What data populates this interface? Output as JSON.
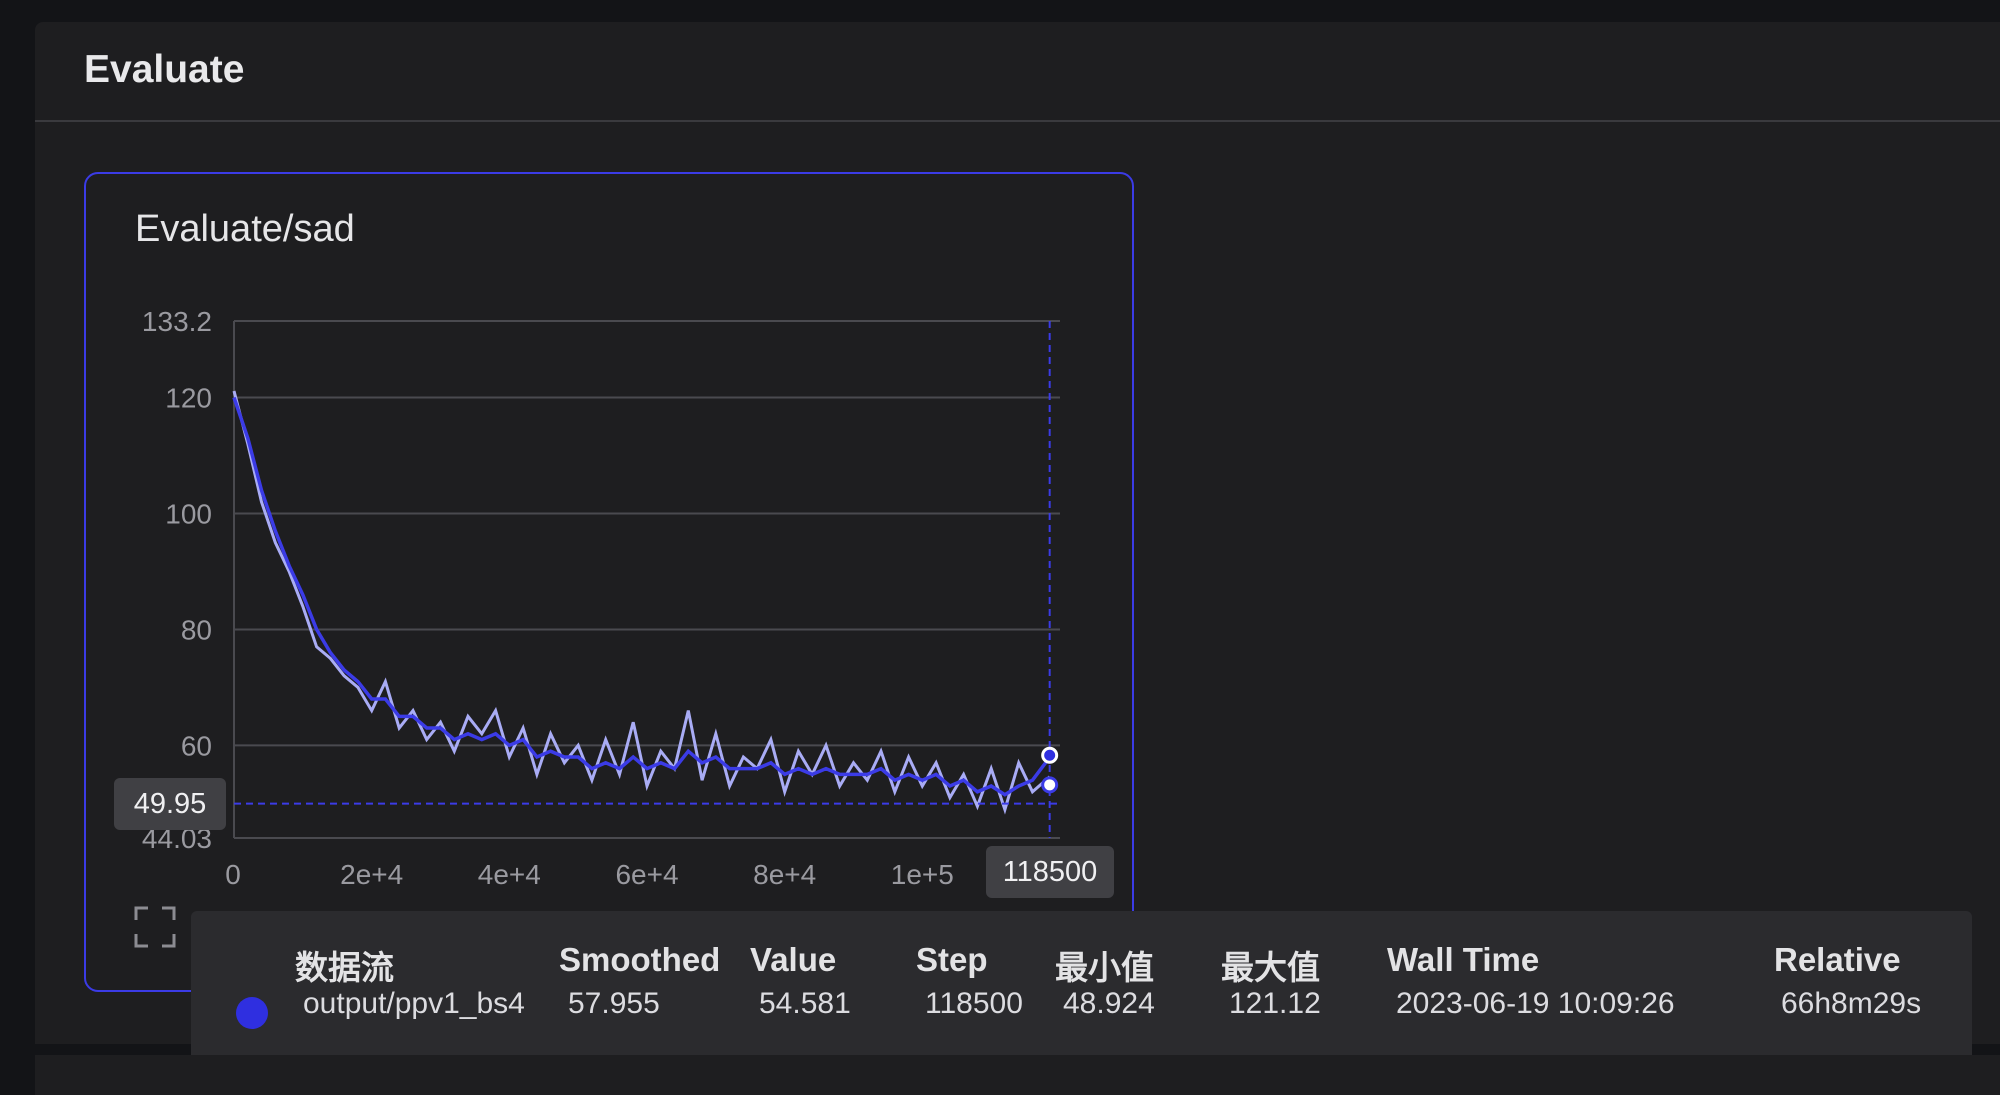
{
  "section": {
    "title": "Evaluate"
  },
  "card": {
    "title": "Evaluate/sad"
  },
  "colors": {
    "accent": "#2f2fe0",
    "smoothed": "#3b3be6",
    "raw": "#a9acf5",
    "card_border": "#3b3be6"
  },
  "hover": {
    "y_value": "49.95",
    "x_value": "118500"
  },
  "chart_data": {
    "type": "line",
    "title": "Evaluate/sad",
    "xlabel": "",
    "ylabel": "",
    "xlim": [
      0,
      120000
    ],
    "ylim": [
      44.03,
      133.2
    ],
    "y_ticks": [
      "133.2",
      "120",
      "100",
      "80",
      "60",
      "44.03"
    ],
    "x_ticks": [
      "0",
      "2e+4",
      "4e+4",
      "6e+4",
      "8e+4",
      "1e+5"
    ],
    "grid": true,
    "series": [
      {
        "name": "output/ppv1_bs4",
        "kind": "raw",
        "x": [
          0,
          2000,
          4000,
          6000,
          8000,
          10000,
          12000,
          14000,
          16000,
          18000,
          20000,
          22000,
          24000,
          26000,
          28000,
          30000,
          32000,
          34000,
          36000,
          38000,
          40000,
          42000,
          44000,
          46000,
          48000,
          50000,
          52000,
          54000,
          56000,
          58000,
          60000,
          62000,
          64000,
          66000,
          68000,
          70000,
          72000,
          74000,
          76000,
          78000,
          80000,
          82000,
          84000,
          86000,
          88000,
          90000,
          92000,
          94000,
          96000,
          98000,
          100000,
          102000,
          104000,
          106000,
          108000,
          110000,
          112000,
          114000,
          116000,
          118500
        ],
        "y": [
          121.12,
          112,
          102,
          95,
          90,
          84,
          77,
          75,
          72,
          70,
          66,
          71,
          63,
          66,
          61,
          64,
          59,
          65,
          62,
          66,
          58,
          63,
          55,
          62,
          57,
          60,
          54,
          61,
          55,
          64,
          53,
          59,
          56,
          66,
          54,
          62,
          53,
          58,
          56,
          61,
          52,
          59,
          55,
          60,
          53,
          57,
          54,
          59,
          52,
          58,
          53,
          57,
          51,
          55,
          49.5,
          56,
          48.924,
          57,
          52,
          54.581
        ]
      },
      {
        "name": "output/ppv1_bs4",
        "kind": "smoothed",
        "x": [
          0,
          2000,
          4000,
          6000,
          8000,
          10000,
          12000,
          14000,
          16000,
          18000,
          20000,
          22000,
          24000,
          26000,
          28000,
          30000,
          32000,
          34000,
          36000,
          38000,
          40000,
          42000,
          44000,
          46000,
          48000,
          50000,
          52000,
          54000,
          56000,
          58000,
          60000,
          62000,
          64000,
          66000,
          68000,
          70000,
          72000,
          74000,
          76000,
          78000,
          80000,
          82000,
          84000,
          86000,
          88000,
          90000,
          92000,
          94000,
          96000,
          98000,
          100000,
          102000,
          104000,
          106000,
          108000,
          110000,
          112000,
          114000,
          116000,
          118500
        ],
        "y": [
          120,
          113,
          104,
          97,
          91,
          86,
          80,
          76,
          73,
          71,
          68,
          68,
          65,
          65,
          63,
          63,
          61,
          62,
          61,
          62,
          60,
          61,
          58,
          59,
          58,
          58,
          56,
          57,
          56,
          58,
          56,
          57,
          56,
          59,
          57,
          58,
          56,
          56,
          56,
          57,
          55,
          56,
          55,
          56,
          55,
          55,
          55,
          56,
          54,
          55,
          54,
          55,
          53,
          54,
          52,
          53,
          51.5,
          53,
          54,
          57.955
        ]
      }
    ]
  },
  "legend_table": {
    "headers": {
      "stream": "数据流",
      "smoothed": "Smoothed",
      "value": "Value",
      "step": "Step",
      "min": "最小值",
      "max": "最大值",
      "wall_time": "Wall Time",
      "relative": "Relative"
    },
    "row": {
      "stream": "output/ppv1_bs4",
      "smoothed": "57.955",
      "value": "54.581",
      "step": "118500",
      "min": "48.924",
      "max": "121.12",
      "wall_time": "2023-06-19 10:09:26",
      "relative": "66h8m29s"
    }
  }
}
